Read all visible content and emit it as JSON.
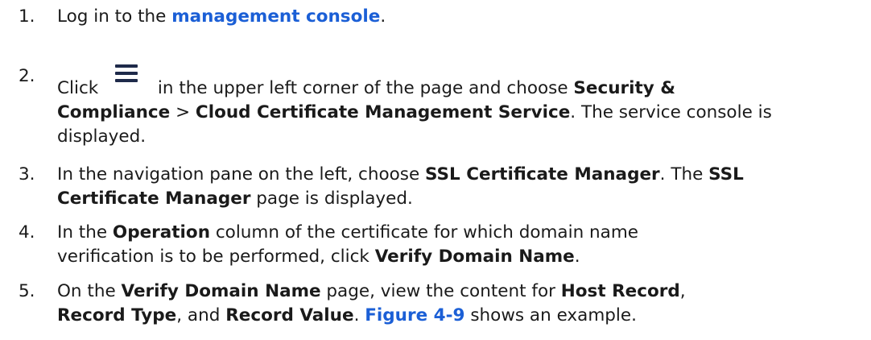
{
  "steps": [
    {
      "number": "1.",
      "text_a": "Log in to the ",
      "link": "management console",
      "text_b": "."
    },
    {
      "number": "2.",
      "text_a": "Click ",
      "icon": "menu-icon",
      "text_b": " in the upper left corner of the page and choose ",
      "bold_a": "Security &",
      "bold_b": "Compliance",
      "text_c": " > ",
      "bold_c": "Cloud Certificate Management Service",
      "text_d": ". The service console is",
      "text_e": "displayed."
    },
    {
      "number": "3.",
      "text_a": "In the navigation pane on the left, choose ",
      "bold_a": "SSL Certificate Manager",
      "text_b": ". The ",
      "bold_b": "SSL",
      "bold_c": "Certificate Manager",
      "text_c": " page is displayed."
    },
    {
      "number": "4.",
      "text_a": "In the ",
      "bold_a": "Operation",
      "text_b": " column of the certificate for which domain name",
      "text_c": "verification is to be performed, click ",
      "bold_b": "Verify Domain Name",
      "text_d": "."
    },
    {
      "number": "5.",
      "text_a": "On the ",
      "bold_a": "Verify Domain Name",
      "text_b": " page, view the content for ",
      "bold_b": "Host Record",
      "text_c": ",",
      "bold_c": "Record Type",
      "text_d": ", and ",
      "bold_d": "Record Value",
      "text_e": ". ",
      "link": "Figure 4-9",
      "text_f": " shows an example."
    }
  ],
  "colors": {
    "link": "#1b5fd6",
    "text": "#1a1a1a",
    "icon": "#1e2a4a"
  }
}
